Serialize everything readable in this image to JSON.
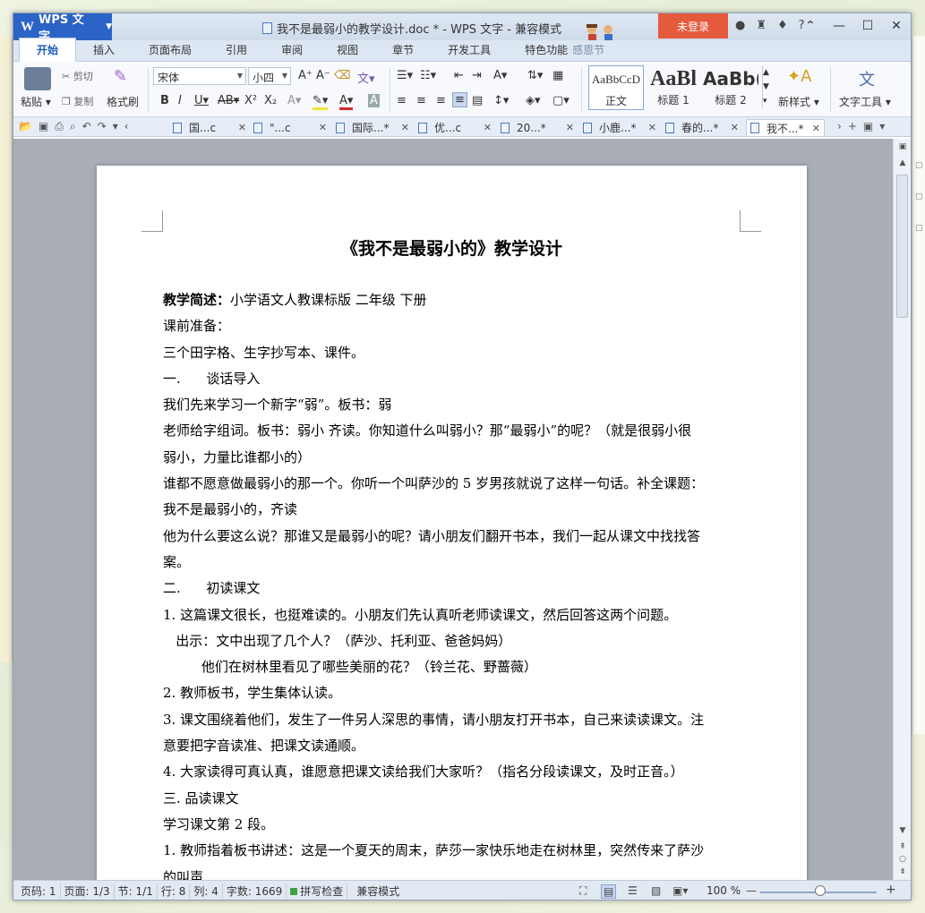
{
  "app": {
    "name": "WPS 文字",
    "title": "我不是最弱小的教学设计.doc * - WPS 文字 - 兼容模式",
    "login": "未登录"
  },
  "menu": {
    "tabs": [
      "开始",
      "插入",
      "页面布局",
      "引用",
      "审阅",
      "视图",
      "章节",
      "开发工具",
      "特色功能"
    ],
    "extra": "感恩节"
  },
  "ribbon": {
    "paste": "粘贴",
    "cut": "剪切",
    "copy": "复制",
    "format_painter": "格式刷",
    "font_name": "宋体",
    "font_size": "小四",
    "styles": [
      {
        "sample": "AaBbCcD",
        "name": "正文"
      },
      {
        "sample": "AaBl",
        "name": "标题 1"
      },
      {
        "sample": "AaBb(",
        "name": "标题 2"
      }
    ],
    "new_style": "新样式",
    "text_tools": "文字工具"
  },
  "doc_tabs": [
    "国...c",
    "\"...c",
    "国际...*",
    "优...c",
    "20...*",
    "小鹿...*",
    "春的...*",
    "我不...*"
  ],
  "document": {
    "title": "《我不是最弱小的》教学设计",
    "summary_label": "教学简述：",
    "summary_value": "小学语文人教课标版 二年级 下册",
    "lines": [
      "课前准备：",
      "三个田字格、生字抄写本、课件。",
      "一.      谈话导入",
      "我们先来学习一个新字“弱”。板书：弱",
      "老师给字组词。板书：弱小 齐读。你知道什么叫弱小？那“最弱小”的呢？（就是很弱小很",
      "弱小，力量比谁都小的）",
      "谁都不愿意做最弱小的那一个。你听一个叫萨沙的 5 岁男孩就说了这样一句话。补全课题：",
      "我不是最弱小的，齐读",
      "他为什么要这么说？那谁又是最弱小的呢？请小朋友们翻开书本，我们一起从课文中找找答",
      "案。",
      "二.      初读课文",
      "1. 这篇课文很长，也挺难读的。小朋友们先认真听老师读课文，然后回答这两个问题。",
      "   出示：文中出现了几个人？（萨沙、托利亚、爸爸妈妈）",
      "         他们在树林里看见了哪些美丽的花？（铃兰花、野蔷薇）",
      "2. 教师板书，学生集体认读。",
      "3. 课文围绕着他们，发生了一件另人深思的事情，请小朋友打开书本，自己来读读课文。注",
      "意要把字音读准、把课文读通顺。",
      "4. 大家读得可真认真，谁愿意把课文读给我们大家听？（指名分段读课文，及时正音。）",
      "三. 品读课文",
      "学习课文第 2 段。",
      "1. 教师指着板书讲述：这是一个夏天的周末，萨莎一家快乐地走在树林里，突然传来了萨沙",
      "的叫声"
    ]
  },
  "status": {
    "page_code": "页码: 1",
    "pages": "页面: 1/3",
    "section": "节: 1/1",
    "row": "行: 8",
    "col": "列: 4",
    "word_count": "字数: 1669",
    "spell_check": "拼写检查",
    "mode": "兼容模式",
    "zoom": "100 %"
  },
  "colors": {
    "app_button": "#2b63c6",
    "login": "#e55a3c",
    "accent": "#2f70cf"
  }
}
